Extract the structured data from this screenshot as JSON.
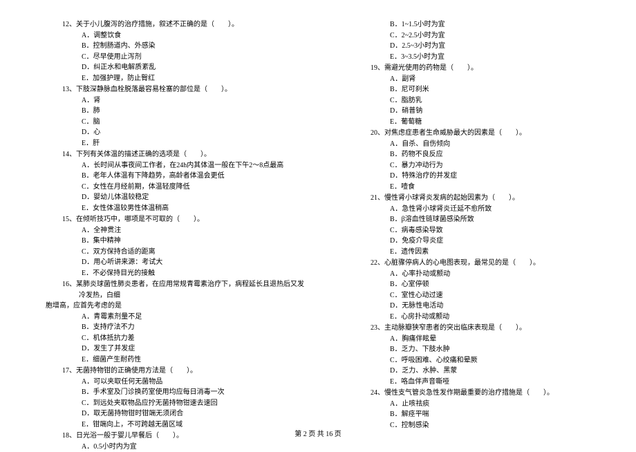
{
  "left": {
    "q12": {
      "stem": "12、关于小儿腹泻的治疗措施，叙述不正确的是（　　）。",
      "opts": [
        "A．调整饮食",
        "B．控制肠道内、外感染",
        "C．尽早使用止泻剂",
        "D．纠正水和电解质紊乱",
        "E．加强护理，防止臀红"
      ]
    },
    "q13": {
      "stem": "13、下肢深静脉血栓脱落最容易栓塞的部位是（　　）。",
      "opts": [
        "A．肾",
        "B．肺",
        "C．脑",
        "D．心",
        "E．肝"
      ]
    },
    "q14": {
      "stem": "14、下列有关体温的描述正确的选项是（　　）。",
      "opts": [
        "A．长时间从事夜间工作者，在24h内其体温一般在下午2～8点最高",
        "B．老年人体温有下降趋势，高龄者体温会更低",
        "C．女性在月经前期，体温轻度降低",
        "D．婴幼儿体温较稳定",
        "E．女性体温较男性体温稍高"
      ]
    },
    "q15": {
      "stem": "15、在倾听技巧中，哪项是不可取的（　　）。",
      "opts": [
        "A．全神贯注",
        "B．集中精神",
        "C．双方保持合适的距离",
        "D．用心听讲来源：考试大",
        "E．不必保持目光的接触"
      ]
    },
    "q16": {
      "stem": "16、某肺炎球菌性肺炎患者，在应用常规青霉素治疗下，病程延长且退热后又发冷发热，白细",
      "cont": "胞增高，应首先考虑的是",
      "opts": [
        "A．青霉素剂量不足",
        "B．支持疗法不力",
        "C．机体抵抗力差",
        "D．发生了并发症",
        "E．细菌产生耐药性"
      ]
    },
    "q17": {
      "stem": "17、无菌持物钳的正确使用方法是（　　）。",
      "opts": [
        "A．可以夹取任何无菌物品",
        "B．手术室及门诊换药室使用均应每日消毒一次",
        "C．到远处夹取物品应拧无菌持物钳速去速回",
        "D．取无菌持物钳时钳端无须闭合",
        "E．钳端向上，不可跨越无菌区域"
      ]
    },
    "q18": {
      "stem": "18、日光浴一般于婴儿早餐后（　　）。",
      "opts": [
        "A．0.5小时内为宜"
      ]
    }
  },
  "right": {
    "q18_cont": [
      "B．1~1.5小时为宜",
      "C．2~2.5小时为宜",
      "D．2.5~3小时为宜",
      "E．3~3.5小时为宜"
    ],
    "q19": {
      "stem": "19、需避光使用的药物是（　　）。",
      "opts": [
        "A．副肾",
        "B．尼可刹米",
        "C．脂肪乳",
        "D．硝普钠",
        "E．葡萄糖"
      ]
    },
    "q20": {
      "stem": "20、对焦虑症患者生命威胁最大的因素是（　　）。",
      "opts": [
        "A．自杀、自伤倾向",
        "B．药物不良反应",
        "C．暴力冲动行为",
        "D．特殊治疗的并发症",
        "E．噎食"
      ]
    },
    "q21": {
      "stem": "21、慢性肾小球肾炎发病的起始因素为（　　）。",
      "opts": [
        "A．急性肾小球肾炎迁延不愈所致",
        "B．β溶血性链球菌感染所致",
        "C．病毒感染导致",
        "D．免疫介导炎症",
        "E．遗传因素"
      ]
    },
    "q22": {
      "stem": "22、心脏骤停病人的心电图表现，最常见的是（　　）。",
      "opts": [
        "A．心率扑动或颤动",
        "B．心室停顿",
        "C．室性心动过速",
        "D．无脉性电活动",
        "E．心房扑动或颤动"
      ]
    },
    "q23": {
      "stem": "23、主动脉瓣狭窄患者的突出临床表现是（　　）。",
      "opts": [
        "A．胸痛伴眩晕",
        "B．乏力、下肢水肿",
        "C．呼吸困难、心绞痛和晕厥",
        "D．乏力、水肿、黑蒙",
        "E．咯血伴声音嘶哑"
      ]
    },
    "q24": {
      "stem": "24、慢性支气管炎急性发作期最重要的治疗措施是（　　）。",
      "opts": [
        "A．止咳祛痰",
        "B．解痉平喘",
        "C．控制感染"
      ]
    }
  },
  "footer": "第 2 页 共 16 页"
}
